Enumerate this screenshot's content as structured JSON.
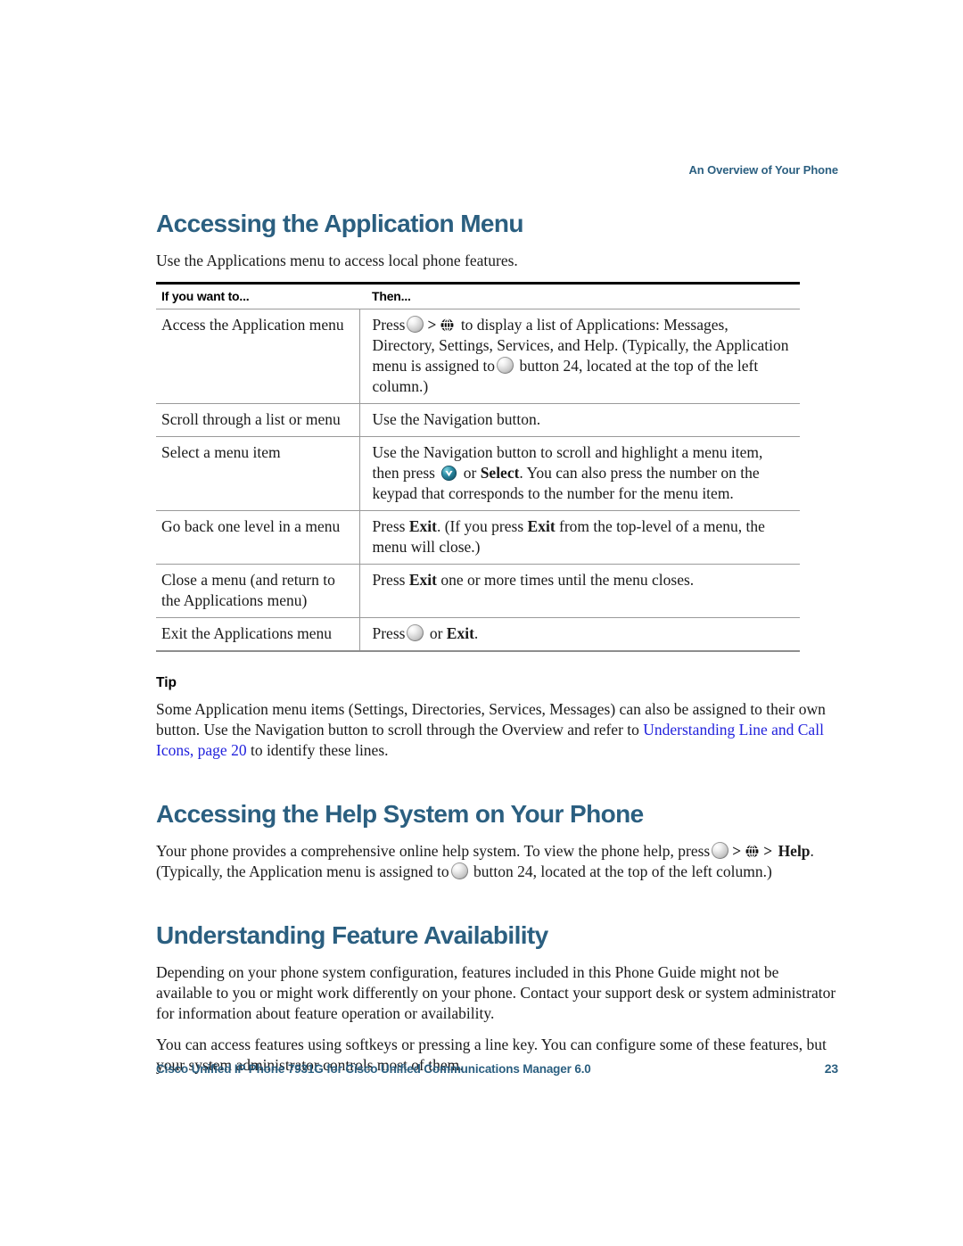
{
  "running_header": "An Overview of Your Phone",
  "colors": {
    "heading_blue": "#2b5f80",
    "link_blue": "#2222dd",
    "body_text": "#1a1a1a"
  },
  "sections": {
    "app_menu": {
      "title": "Accessing the Application Menu",
      "intro": "Use the Applications menu to access local phone features.",
      "table": {
        "headers": [
          "If you want to...",
          "Then..."
        ],
        "rows": [
          {
            "want": "Access the Application menu",
            "then_parts": {
              "p1": "Press",
              "p2": ">",
              "p3": "to display a list of Applications: Messages, Directory, Settings, Services, and Help. (Typically, the Application menu is assigned to",
              "p4": "button 24, located at the top of the left column.)"
            }
          },
          {
            "want": "Scroll through a list or menu",
            "then_parts": {
              "p1": "Use the Navigation button."
            }
          },
          {
            "want": "Select a menu item",
            "then_parts": {
              "p1": "Use the Navigation button to scroll and highlight a menu item, then press",
              "p2": "or",
              "p3": "Select",
              "p4": ". You can also press the number on the keypad that corresponds to the number for the menu item."
            }
          },
          {
            "want": "Go back one level in a menu",
            "then_parts": {
              "p1": "Press",
              "p2": "Exit",
              "p3": ". (If you press",
              "p4": "Exit",
              "p5": "from the top-level of a menu, the menu will close.)"
            }
          },
          {
            "want": "Close a menu (and return to the Applications menu)",
            "then_parts": {
              "p1": "Press",
              "p2": "Exit",
              "p3": "one or more times until the menu closes."
            }
          },
          {
            "want": "Exit the Applications menu",
            "then_parts": {
              "p1": "Press",
              "p2": "or",
              "p3": "Exit",
              "p4": "."
            }
          }
        ]
      },
      "tip": {
        "label": "Tip",
        "text_before_link": "Some Application menu items (Settings, Directories, Services, Messages) can also be assigned to their own button. Use the Navigation button to scroll through the Overview and refer to ",
        "link_text": "Understanding Line and Call Icons, page 20",
        "text_after_link": " to identify these lines."
      }
    },
    "help_system": {
      "title": "Accessing the Help System on Your Phone",
      "paragraph_parts": {
        "p1": "Your phone provides a comprehensive online help system. To view the phone help, press",
        "p2": ">",
        "p3": ">",
        "p4": "Help",
        "p5": ". (Typically, the Application menu is assigned to",
        "p6": "button 24, located at the top of the left column.)"
      }
    },
    "feature_availability": {
      "title": "Understanding Feature Availability",
      "paragraphs": [
        "Depending on your phone system configuration, features included in this Phone Guide might not be available to you or might work differently on your phone. Contact your support desk or system administrator for information about feature operation or availability.",
        "You can access features using softkeys or pressing a line key. You can configure some of these features, but your system administrator controls most of them."
      ]
    }
  },
  "footer": {
    "text": "Cisco Unified IP Phone 7931G for Cisco Unified Communications Manager 6.0",
    "page_number": "23"
  },
  "icons": {
    "round_button": "round-button-icon",
    "globe": "globe-icon",
    "select": "select-check-icon"
  }
}
